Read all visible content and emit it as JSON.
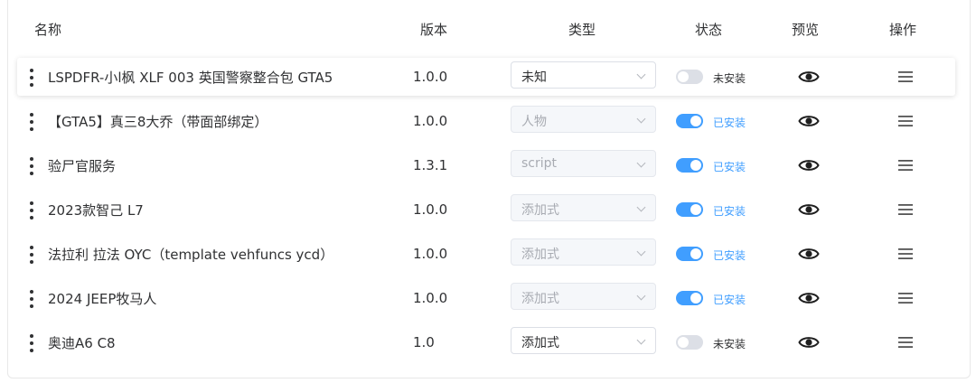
{
  "table": {
    "headers": {
      "name": "名称",
      "version": "版本",
      "type": "类型",
      "status": "状态",
      "preview": "预览",
      "ops": "操作"
    },
    "rows": [
      {
        "name": "LSPDFR-小l枫 XLF 003 英国警察整合包 GTA5",
        "version": "1.0.0",
        "type": "未知",
        "type_disabled": false,
        "installed": false,
        "status": "未安装",
        "active": true
      },
      {
        "name": "【GTA5】真三8大乔（带面部绑定）",
        "version": "1.0.0",
        "type": "人物",
        "type_disabled": true,
        "installed": true,
        "status": "已安装",
        "active": false
      },
      {
        "name": "验尸官服务",
        "version": "1.3.1",
        "type": "script",
        "type_disabled": true,
        "installed": true,
        "status": "已安装",
        "active": false
      },
      {
        "name": "2023款智己 L7",
        "version": "1.0.0",
        "type": "添加式",
        "type_disabled": true,
        "installed": true,
        "status": "已安装",
        "active": false
      },
      {
        "name": "法拉利 拉法 OYC（template vehfuncs ycd）",
        "version": "1.0.0",
        "type": "添加式",
        "type_disabled": true,
        "installed": true,
        "status": "已安装",
        "active": false
      },
      {
        "name": "2024 JEEP牧马人",
        "version": "1.0.0",
        "type": "添加式",
        "type_disabled": true,
        "installed": true,
        "status": "已安装",
        "active": false
      },
      {
        "name": "奥迪A6 C8",
        "version": "1.0",
        "type": "添加式",
        "type_disabled": false,
        "installed": false,
        "status": "未安装",
        "active": false
      }
    ]
  },
  "icons": {
    "drag": "drag-handle-icon",
    "preview": "eye-icon",
    "ops": "menu-icon",
    "select": "chevron-down-icon"
  },
  "colors": {
    "accent": "#409eff",
    "toggle_off": "#dcdfe6",
    "text": "#303133",
    "muted": "#a8abb2"
  }
}
